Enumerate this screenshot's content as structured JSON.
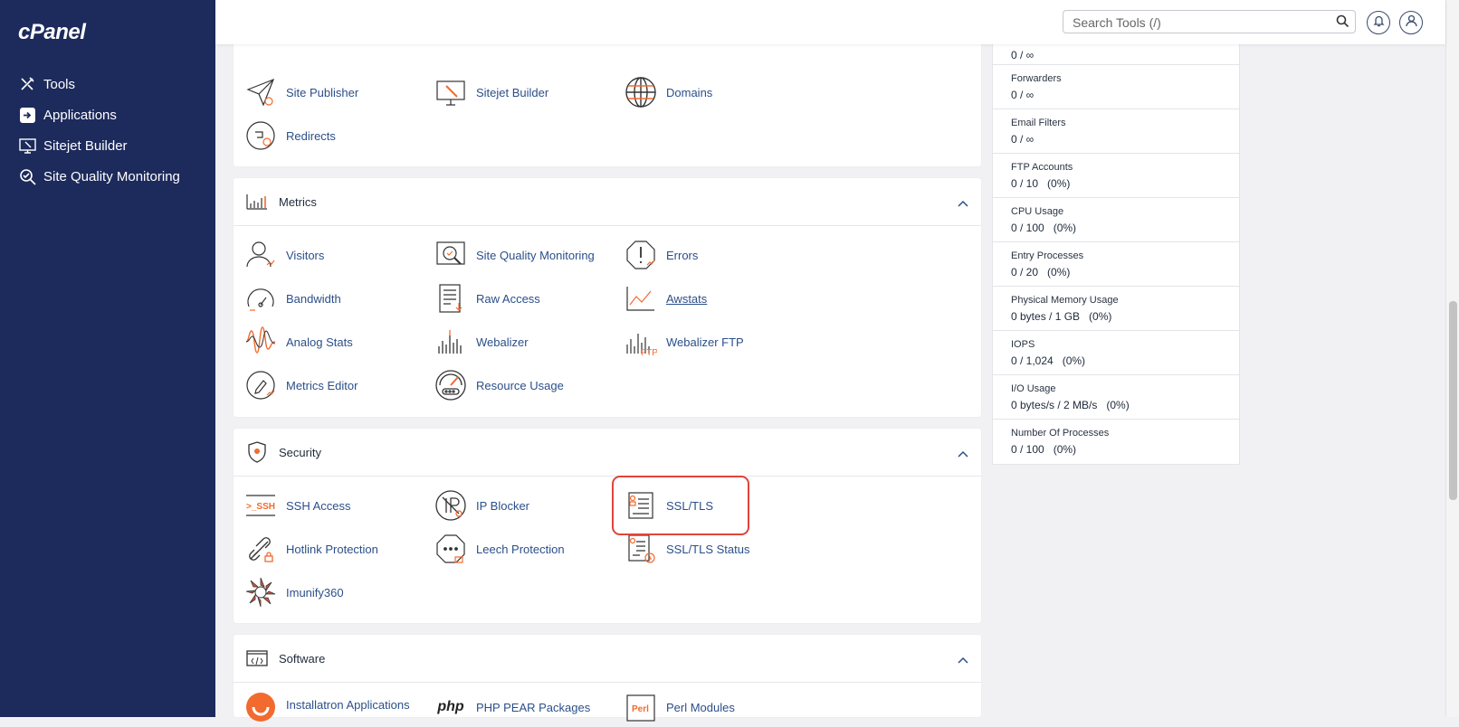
{
  "brand": {
    "logo": "cPanel"
  },
  "sidebar": {
    "items": [
      {
        "label": "Tools",
        "icon": "tools-icon"
      },
      {
        "label": "Applications",
        "icon": "applications-icon"
      },
      {
        "label": "Sitejet Builder",
        "icon": "sitejet-icon"
      },
      {
        "label": "Site Quality Monitoring",
        "icon": "site-quality-icon"
      }
    ]
  },
  "topbar": {
    "search_placeholder": "Search Tools (/)"
  },
  "domains_section": {
    "tools": [
      {
        "label": "Site Publisher",
        "icon": "site-publisher-icon"
      },
      {
        "label": "Sitejet Builder",
        "icon": "sitejet-builder-icon"
      },
      {
        "label": "Domains",
        "icon": "globe-icon"
      },
      {
        "label": "Redirects",
        "icon": "redirects-icon"
      }
    ]
  },
  "metrics_section": {
    "title": "Metrics",
    "tools": [
      {
        "label": "Visitors",
        "icon": "visitors-icon"
      },
      {
        "label": "Site Quality Monitoring",
        "icon": "site-quality-monitoring-icon"
      },
      {
        "label": "Errors",
        "icon": "errors-icon"
      },
      {
        "label": "Bandwidth",
        "icon": "bandwidth-icon"
      },
      {
        "label": "Raw Access",
        "icon": "raw-access-icon"
      },
      {
        "label": "Awstats",
        "icon": "awstats-icon"
      },
      {
        "label": "Analog Stats",
        "icon": "analog-stats-icon"
      },
      {
        "label": "Webalizer",
        "icon": "webalizer-icon"
      },
      {
        "label": "Webalizer FTP",
        "icon": "webalizer-ftp-icon"
      },
      {
        "label": "Metrics Editor",
        "icon": "metrics-editor-icon"
      },
      {
        "label": "Resource Usage",
        "icon": "resource-usage-icon"
      }
    ]
  },
  "security_section": {
    "title": "Security",
    "tools": [
      {
        "label": "SSH Access",
        "icon": "ssh-icon"
      },
      {
        "label": "IP Blocker",
        "icon": "ip-blocker-icon"
      },
      {
        "label": "SSL/TLS",
        "icon": "ssl-tls-icon"
      },
      {
        "label": "Hotlink Protection",
        "icon": "hotlink-icon"
      },
      {
        "label": "Leech Protection",
        "icon": "leech-icon"
      },
      {
        "label": "SSL/TLS Status",
        "icon": "ssl-status-icon"
      },
      {
        "label": "Imunify360",
        "icon": "imunify-icon"
      }
    ]
  },
  "software_section": {
    "title": "Software",
    "tools": [
      {
        "label": "Installatron Applications",
        "icon": "installatron-icon"
      },
      {
        "label": "PHP PEAR Packages",
        "icon": "php-icon"
      },
      {
        "label": "Perl Modules",
        "icon": "perl-icon"
      }
    ]
  },
  "icon_text": {
    "ssh": ">_SSH",
    "ftp": "FTP",
    "php": "php",
    "perl": "Perl"
  },
  "stats": {
    "top_value": "0 / ∞",
    "items": [
      {
        "label": "Forwarders",
        "value": "0 / ∞"
      },
      {
        "label": "Email Filters",
        "value": "0 / ∞"
      },
      {
        "label": "FTP Accounts",
        "value": "0 / 10   (0%)"
      },
      {
        "label": "CPU Usage",
        "value": "0 / 100   (0%)"
      },
      {
        "label": "Entry Processes",
        "value": "0 / 20   (0%)"
      },
      {
        "label": "Physical Memory Usage",
        "value": "0 bytes / 1 GB   (0%)"
      },
      {
        "label": "IOPS",
        "value": "0 / 1,024   (0%)"
      },
      {
        "label": "I/O Usage",
        "value": "0 bytes/s / 2 MB/s   (0%)"
      },
      {
        "label": "Number Of Processes",
        "value": "0 / 100   (0%)"
      }
    ]
  },
  "colors": {
    "sidebar": "#1d2a5c",
    "link": "#2b4f8a",
    "accent": "#f26a2e",
    "highlight": "#e0453a"
  }
}
